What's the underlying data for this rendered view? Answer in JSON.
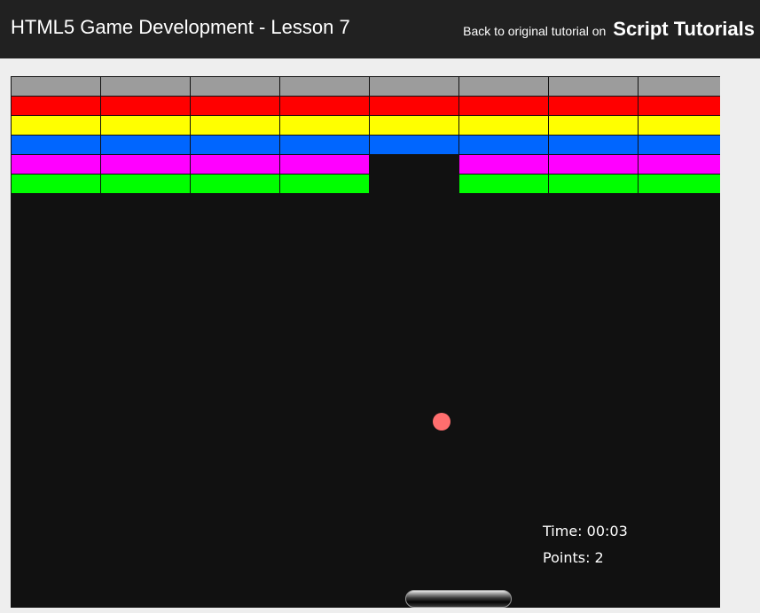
{
  "header": {
    "title": "HTML5 Game Development - Lesson 7",
    "back_text": "Back to original tutorial on",
    "site_name": "Script Tutorials"
  },
  "game": {
    "time_text": "Time: 00:03",
    "points_text": "Points: 2",
    "columns": 8,
    "rows": [
      {
        "color": "#9c9c9c",
        "present": [
          true,
          true,
          true,
          true,
          true,
          true,
          true,
          true
        ]
      },
      {
        "color": "#ff0000",
        "present": [
          true,
          true,
          true,
          true,
          true,
          true,
          true,
          true
        ]
      },
      {
        "color": "#ffff00",
        "present": [
          true,
          true,
          true,
          true,
          true,
          true,
          true,
          true
        ]
      },
      {
        "color": "#0066ff",
        "present": [
          true,
          true,
          true,
          true,
          true,
          true,
          true,
          true
        ]
      },
      {
        "color": "#ff00ff",
        "present": [
          true,
          true,
          true,
          true,
          false,
          true,
          true,
          true
        ]
      },
      {
        "color": "#00ff00",
        "present": [
          true,
          true,
          true,
          true,
          false,
          true,
          true,
          true
        ]
      }
    ],
    "ball_color": "#ff6e6e",
    "canvas_color": "#111111"
  }
}
